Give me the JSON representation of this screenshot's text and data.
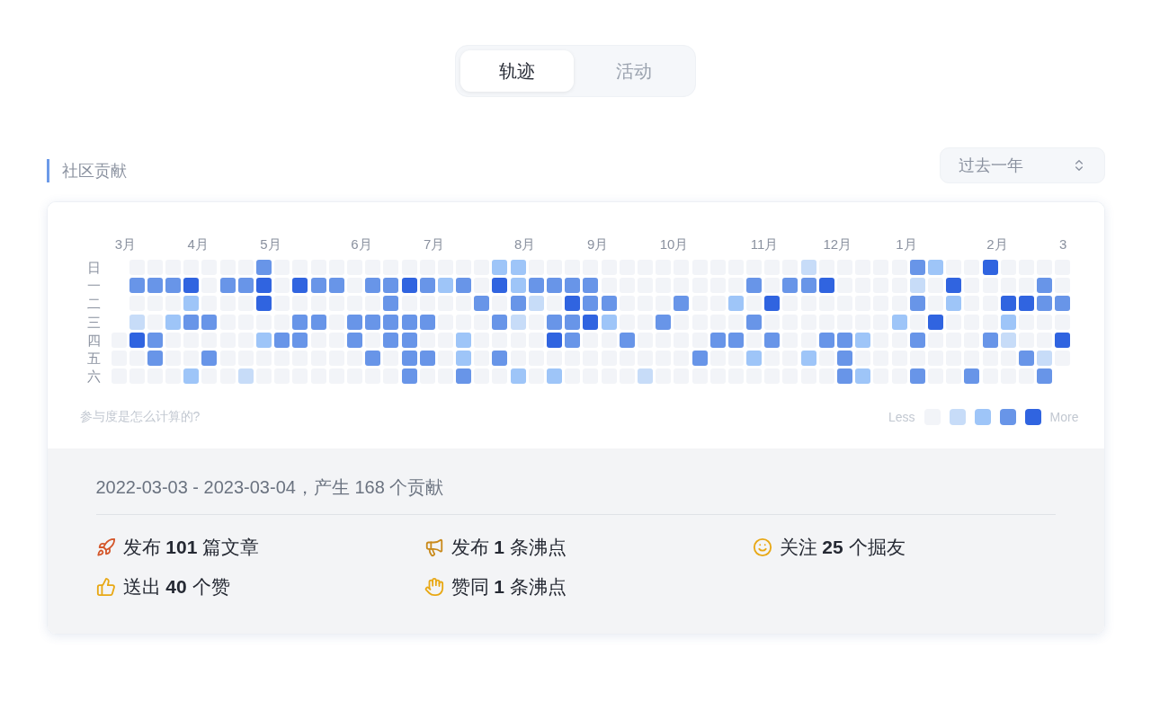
{
  "tabs": [
    {
      "label": "轨迹",
      "selected": true
    },
    {
      "label": "活动",
      "selected": false
    }
  ],
  "section": {
    "title": "社区贡献",
    "range_select": {
      "value": "过去一年"
    }
  },
  "heatmap": {
    "months": [
      "3月",
      "4月",
      "5月",
      "6月",
      "7月",
      "8月",
      "9月",
      "10月",
      "11月",
      "12月",
      "1月",
      "2月",
      "3"
    ],
    "days": [
      "日",
      "一",
      "二",
      "三",
      "四",
      "五",
      "六"
    ],
    "weeks": [
      {
        "days": [
          {
            "color": "#f2f4f8"
          },
          {
            "color": "#f2f4f8"
          },
          {
            "color": "#f2f4f8"
          }
        ]
      },
      {
        "days": [
          {
            "color": "#f2f4f8"
          },
          {
            "color": "#6895e8"
          },
          {
            "color": "#f2f4f8"
          },
          {
            "color": "#c7dcf8"
          },
          {
            "color": "#3064e0"
          },
          {
            "color": "#f2f4f8"
          },
          {
            "color": "#f2f4f8"
          }
        ]
      },
      {
        "days": [
          {
            "color": "#f2f4f8"
          },
          {
            "color": "#6895e8"
          },
          {
            "color": "#f2f4f8"
          },
          {
            "color": "#f2f4f8"
          },
          {
            "color": "#6895e8"
          },
          {
            "color": "#6895e8"
          },
          {
            "color": "#f2f4f8"
          }
        ]
      },
      {
        "days": [
          {
            "color": "#f2f4f8"
          },
          {
            "color": "#6895e8"
          },
          {
            "color": "#f2f4f8"
          },
          {
            "color": "#9ec5f8"
          },
          {
            "color": "#f2f4f8"
          },
          {
            "color": "#f2f4f8"
          },
          {
            "color": "#f2f4f8"
          }
        ]
      },
      {
        "days": [
          {
            "color": "#f2f4f8"
          },
          {
            "color": "#3064e0"
          },
          {
            "color": "#9ec5f8"
          },
          {
            "color": "#6895e8"
          },
          {
            "color": "#f2f4f8"
          },
          {
            "color": "#f2f4f8"
          },
          {
            "color": "#9ec5f8"
          }
        ]
      },
      {
        "days": [
          {
            "color": "#f2f4f8"
          },
          {
            "color": "#f2f4f8"
          },
          {
            "color": "#f2f4f8"
          },
          {
            "color": "#6895e8"
          },
          {
            "color": "#f2f4f8"
          },
          {
            "color": "#6895e8"
          },
          {
            "color": "#f2f4f8"
          }
        ]
      },
      {
        "days": [
          {
            "color": "#f2f4f8"
          },
          {
            "color": "#6895e8"
          },
          {
            "color": "#f2f4f8"
          },
          {
            "color": "#f2f4f8"
          },
          {
            "color": "#f2f4f8"
          },
          {
            "color": "#f2f4f8"
          },
          {
            "color": "#f2f4f8"
          }
        ]
      },
      {
        "days": [
          {
            "color": "#f2f4f8"
          },
          {
            "color": "#6895e8"
          },
          {
            "color": "#f2f4f8"
          },
          {
            "color": "#f2f4f8"
          },
          {
            "color": "#f2f4f8"
          },
          {
            "color": "#f2f4f8"
          },
          {
            "color": "#c7dcf8"
          }
        ]
      },
      {
        "days": [
          {
            "color": "#6895e8"
          },
          {
            "color": "#3064e0"
          },
          {
            "color": "#3064e0"
          },
          {
            "color": "#f2f4f8"
          },
          {
            "color": "#9ec5f8"
          },
          {
            "color": "#f2f4f8"
          },
          {
            "color": "#f2f4f8"
          }
        ]
      },
      {
        "days": [
          {
            "color": "#f2f4f8"
          },
          {
            "color": "#f2f4f8"
          },
          {
            "color": "#f2f4f8"
          },
          {
            "color": "#f2f4f8"
          },
          {
            "color": "#6895e8"
          },
          {
            "color": "#f2f4f8"
          },
          {
            "color": "#f2f4f8"
          }
        ]
      },
      {
        "days": [
          {
            "color": "#f2f4f8"
          },
          {
            "color": "#3064e0"
          },
          {
            "color": "#f2f4f8"
          },
          {
            "color": "#6895e8"
          },
          {
            "color": "#6895e8"
          },
          {
            "color": "#f2f4f8"
          },
          {
            "color": "#f2f4f8"
          }
        ]
      },
      {
        "days": [
          {
            "color": "#f2f4f8"
          },
          {
            "color": "#6895e8"
          },
          {
            "color": "#f2f4f8"
          },
          {
            "color": "#6895e8"
          },
          {
            "color": "#f2f4f8"
          },
          {
            "color": "#f2f4f8"
          },
          {
            "color": "#f2f4f8"
          }
        ]
      },
      {
        "days": [
          {
            "color": "#f2f4f8"
          },
          {
            "color": "#6895e8"
          },
          {
            "color": "#f2f4f8"
          },
          {
            "color": "#f2f4f8"
          },
          {
            "color": "#f2f4f8"
          },
          {
            "color": "#f2f4f8"
          },
          {
            "color": "#f2f4f8"
          }
        ]
      },
      {
        "days": [
          {
            "color": "#f2f4f8"
          },
          {
            "color": "#f2f4f8"
          },
          {
            "color": "#f2f4f8"
          },
          {
            "color": "#6895e8"
          },
          {
            "color": "#6895e8"
          },
          {
            "color": "#f2f4f8"
          },
          {
            "color": "#f2f4f8"
          }
        ]
      },
      {
        "days": [
          {
            "color": "#f2f4f8"
          },
          {
            "color": "#6895e8"
          },
          {
            "color": "#f2f4f8"
          },
          {
            "color": "#6895e8"
          },
          {
            "color": "#f2f4f8"
          },
          {
            "color": "#6895e8"
          },
          {
            "color": "#f2f4f8"
          }
        ]
      },
      {
        "days": [
          {
            "color": "#f2f4f8"
          },
          {
            "color": "#6895e8"
          },
          {
            "color": "#6895e8"
          },
          {
            "color": "#6895e8"
          },
          {
            "color": "#6895e8"
          },
          {
            "color": "#f2f4f8"
          },
          {
            "color": "#f2f4f8"
          }
        ]
      },
      {
        "days": [
          {
            "color": "#f2f4f8"
          },
          {
            "color": "#3064e0"
          },
          {
            "color": "#f2f4f8"
          },
          {
            "color": "#6895e8"
          },
          {
            "color": "#6895e8"
          },
          {
            "color": "#6895e8"
          },
          {
            "color": "#6895e8"
          }
        ]
      },
      {
        "days": [
          {
            "color": "#f2f4f8"
          },
          {
            "color": "#6895e8"
          },
          {
            "color": "#f2f4f8"
          },
          {
            "color": "#6895e8"
          },
          {
            "color": "#f2f4f8"
          },
          {
            "color": "#6895e8"
          },
          {
            "color": "#f2f4f8"
          }
        ]
      },
      {
        "days": [
          {
            "color": "#f2f4f8"
          },
          {
            "color": "#9ec5f8"
          },
          {
            "color": "#f2f4f8"
          },
          {
            "color": "#f2f4f8"
          },
          {
            "color": "#f2f4f8"
          },
          {
            "color": "#f2f4f8"
          },
          {
            "color": "#f2f4f8"
          }
        ]
      },
      {
        "days": [
          {
            "color": "#f2f4f8"
          },
          {
            "color": "#6895e8"
          },
          {
            "color": "#f2f4f8"
          },
          {
            "color": "#f2f4f8"
          },
          {
            "color": "#9ec5f8"
          },
          {
            "color": "#9ec5f8"
          },
          {
            "color": "#6895e8"
          }
        ]
      },
      {
        "days": [
          {
            "color": "#f2f4f8"
          },
          {
            "color": "#f2f4f8"
          },
          {
            "color": "#6895e8"
          },
          {
            "color": "#f2f4f8"
          },
          {
            "color": "#f2f4f8"
          },
          {
            "color": "#f2f4f8"
          },
          {
            "color": "#f2f4f8"
          }
        ]
      },
      {
        "days": [
          {
            "color": "#9ec5f8"
          },
          {
            "color": "#3064e0"
          },
          {
            "color": "#f2f4f8"
          },
          {
            "color": "#6895e8"
          },
          {
            "color": "#f2f4f8"
          },
          {
            "color": "#6895e8"
          },
          {
            "color": "#f2f4f8"
          }
        ]
      },
      {
        "days": [
          {
            "color": "#9ec5f8"
          },
          {
            "color": "#9ec5f8"
          },
          {
            "color": "#6895e8"
          },
          {
            "color": "#c7dcf8"
          },
          {
            "color": "#f2f4f8"
          },
          {
            "color": "#f2f4f8"
          },
          {
            "color": "#9ec5f8"
          }
        ]
      },
      {
        "days": [
          {
            "color": "#f2f4f8"
          },
          {
            "color": "#6895e8"
          },
          {
            "color": "#c7dcf8"
          },
          {
            "color": "#f2f4f8"
          },
          {
            "color": "#f2f4f8"
          },
          {
            "color": "#f2f4f8"
          },
          {
            "color": "#f2f4f8"
          }
        ]
      },
      {
        "days": [
          {
            "color": "#f2f4f8"
          },
          {
            "color": "#6895e8"
          },
          {
            "color": "#f2f4f8"
          },
          {
            "color": "#6895e8"
          },
          {
            "color": "#3064e0"
          },
          {
            "color": "#f2f4f8"
          },
          {
            "color": "#9ec5f8"
          }
        ]
      },
      {
        "days": [
          {
            "color": "#f2f4f8"
          },
          {
            "color": "#6895e8"
          },
          {
            "color": "#3064e0"
          },
          {
            "color": "#6895e8"
          },
          {
            "color": "#6895e8"
          },
          {
            "color": "#f2f4f8"
          },
          {
            "color": "#f2f4f8"
          }
        ]
      },
      {
        "days": [
          {
            "color": "#f2f4f8"
          },
          {
            "color": "#6895e8"
          },
          {
            "color": "#6895e8"
          },
          {
            "color": "#3064e0"
          },
          {
            "color": "#f2f4f8"
          },
          {
            "color": "#f2f4f8"
          },
          {
            "color": "#f2f4f8"
          }
        ]
      },
      {
        "days": [
          {
            "color": "#f2f4f8"
          },
          {
            "color": "#f2f4f8"
          },
          {
            "color": "#6895e8"
          },
          {
            "color": "#9ec5f8"
          },
          {
            "color": "#f2f4f8"
          },
          {
            "color": "#f2f4f8"
          },
          {
            "color": "#f2f4f8"
          }
        ]
      },
      {
        "days": [
          {
            "color": "#f2f4f8"
          },
          {
            "color": "#f2f4f8"
          },
          {
            "color": "#f2f4f8"
          },
          {
            "color": "#f2f4f8"
          },
          {
            "color": "#6895e8"
          },
          {
            "color": "#f2f4f8"
          },
          {
            "color": "#f2f4f8"
          }
        ]
      },
      {
        "days": [
          {
            "color": "#f2f4f8"
          },
          {
            "color": "#f2f4f8"
          },
          {
            "color": "#f2f4f8"
          },
          {
            "color": "#f2f4f8"
          },
          {
            "color": "#f2f4f8"
          },
          {
            "color": "#f2f4f8"
          },
          {
            "color": "#c7dcf8"
          }
        ]
      },
      {
        "days": [
          {
            "color": "#f2f4f8"
          },
          {
            "color": "#f2f4f8"
          },
          {
            "color": "#f2f4f8"
          },
          {
            "color": "#6895e8"
          },
          {
            "color": "#f2f4f8"
          },
          {
            "color": "#f2f4f8"
          },
          {
            "color": "#f2f4f8"
          }
        ]
      },
      {
        "days": [
          {
            "color": "#f2f4f8"
          },
          {
            "color": "#f2f4f8"
          },
          {
            "color": "#6895e8"
          },
          {
            "color": "#f2f4f8"
          },
          {
            "color": "#f2f4f8"
          },
          {
            "color": "#f2f4f8"
          },
          {
            "color": "#f2f4f8"
          }
        ]
      },
      {
        "days": [
          {
            "color": "#f2f4f8"
          },
          {
            "color": "#f2f4f8"
          },
          {
            "color": "#f2f4f8"
          },
          {
            "color": "#f2f4f8"
          },
          {
            "color": "#f2f4f8"
          },
          {
            "color": "#6895e8"
          },
          {
            "color": "#f2f4f8"
          }
        ]
      },
      {
        "days": [
          {
            "color": "#f2f4f8"
          },
          {
            "color": "#f2f4f8"
          },
          {
            "color": "#f2f4f8"
          },
          {
            "color": "#f2f4f8"
          },
          {
            "color": "#6895e8"
          },
          {
            "color": "#f2f4f8"
          },
          {
            "color": "#f2f4f8"
          }
        ]
      },
      {
        "days": [
          {
            "color": "#f2f4f8"
          },
          {
            "color": "#f2f4f8"
          },
          {
            "color": "#9ec5f8"
          },
          {
            "color": "#f2f4f8"
          },
          {
            "color": "#6895e8"
          },
          {
            "color": "#f2f4f8"
          },
          {
            "color": "#f2f4f8"
          }
        ]
      },
      {
        "days": [
          {
            "color": "#f2f4f8"
          },
          {
            "color": "#6895e8"
          },
          {
            "color": "#f2f4f8"
          },
          {
            "color": "#6895e8"
          },
          {
            "color": "#f2f4f8"
          },
          {
            "color": "#9ec5f8"
          },
          {
            "color": "#f2f4f8"
          }
        ]
      },
      {
        "days": [
          {
            "color": "#f2f4f8"
          },
          {
            "color": "#f2f4f8"
          },
          {
            "color": "#3064e0"
          },
          {
            "color": "#f2f4f8"
          },
          {
            "color": "#6895e8"
          },
          {
            "color": "#f2f4f8"
          },
          {
            "color": "#f2f4f8"
          }
        ]
      },
      {
        "days": [
          {
            "color": "#f2f4f8"
          },
          {
            "color": "#6895e8"
          },
          {
            "color": "#f2f4f8"
          },
          {
            "color": "#f2f4f8"
          },
          {
            "color": "#f2f4f8"
          },
          {
            "color": "#f2f4f8"
          },
          {
            "color": "#f2f4f8"
          }
        ]
      },
      {
        "days": [
          {
            "color": "#c7dcf8"
          },
          {
            "color": "#6895e8"
          },
          {
            "color": "#f2f4f8"
          },
          {
            "color": "#f2f4f8"
          },
          {
            "color": "#f2f4f8"
          },
          {
            "color": "#9ec5f8"
          },
          {
            "color": "#f2f4f8"
          }
        ]
      },
      {
        "days": [
          {
            "color": "#f2f4f8"
          },
          {
            "color": "#3064e0"
          },
          {
            "color": "#f2f4f8"
          },
          {
            "color": "#f2f4f8"
          },
          {
            "color": "#6895e8"
          },
          {
            "color": "#f2f4f8"
          },
          {
            "color": "#f2f4f8"
          }
        ]
      },
      {
        "days": [
          {
            "color": "#f2f4f8"
          },
          {
            "color": "#f2f4f8"
          },
          {
            "color": "#f2f4f8"
          },
          {
            "color": "#f2f4f8"
          },
          {
            "color": "#6895e8"
          },
          {
            "color": "#6895e8"
          },
          {
            "color": "#6895e8"
          }
        ]
      },
      {
        "days": [
          {
            "color": "#f2f4f8"
          },
          {
            "color": "#f2f4f8"
          },
          {
            "color": "#f2f4f8"
          },
          {
            "color": "#f2f4f8"
          },
          {
            "color": "#9ec5f8"
          },
          {
            "color": "#f2f4f8"
          },
          {
            "color": "#9ec5f8"
          }
        ]
      },
      {
        "days": [
          {
            "color": "#f2f4f8"
          },
          {
            "color": "#f2f4f8"
          },
          {
            "color": "#f2f4f8"
          },
          {
            "color": "#f2f4f8"
          },
          {
            "color": "#f2f4f8"
          },
          {
            "color": "#f2f4f8"
          },
          {
            "color": "#f2f4f8"
          }
        ]
      },
      {
        "days": [
          {
            "color": "#f2f4f8"
          },
          {
            "color": "#f2f4f8"
          },
          {
            "color": "#f2f4f8"
          },
          {
            "color": "#9ec5f8"
          },
          {
            "color": "#f2f4f8"
          },
          {
            "color": "#f2f4f8"
          },
          {
            "color": "#f2f4f8"
          }
        ]
      },
      {
        "days": [
          {
            "color": "#6895e8"
          },
          {
            "color": "#c7dcf8"
          },
          {
            "color": "#6895e8"
          },
          {
            "color": "#f2f4f8"
          },
          {
            "color": "#6895e8"
          },
          {
            "color": "#f2f4f8"
          },
          {
            "color": "#6895e8"
          }
        ]
      },
      {
        "days": [
          {
            "color": "#9ec5f8"
          },
          {
            "color": "#f2f4f8"
          },
          {
            "color": "#f2f4f8"
          },
          {
            "color": "#3064e0"
          },
          {
            "color": "#f2f4f8"
          },
          {
            "color": "#f2f4f8"
          },
          {
            "color": "#f2f4f8"
          }
        ]
      },
      {
        "days": [
          {
            "color": "#f2f4f8"
          },
          {
            "color": "#3064e0"
          },
          {
            "color": "#9ec5f8"
          },
          {
            "color": "#f2f4f8"
          },
          {
            "color": "#f2f4f8"
          },
          {
            "color": "#f2f4f8"
          },
          {
            "color": "#f2f4f8"
          }
        ]
      },
      {
        "days": [
          {
            "color": "#f2f4f8"
          },
          {
            "color": "#f2f4f8"
          },
          {
            "color": "#f2f4f8"
          },
          {
            "color": "#f2f4f8"
          },
          {
            "color": "#f2f4f8"
          },
          {
            "color": "#f2f4f8"
          },
          {
            "color": "#6895e8"
          }
        ]
      },
      {
        "days": [
          {
            "color": "#3064e0"
          },
          {
            "color": "#f2f4f8"
          },
          {
            "color": "#f2f4f8"
          },
          {
            "color": "#f2f4f8"
          },
          {
            "color": "#6895e8"
          },
          {
            "color": "#f2f4f8"
          },
          {
            "color": "#f2f4f8"
          }
        ]
      },
      {
        "days": [
          {
            "color": "#f2f4f8"
          },
          {
            "color": "#f2f4f8"
          },
          {
            "color": "#3064e0"
          },
          {
            "color": "#9ec5f8"
          },
          {
            "color": "#c7dcf8"
          },
          {
            "color": "#f2f4f8"
          },
          {
            "color": "#f2f4f8"
          }
        ]
      },
      {
        "days": [
          {
            "color": "#f2f4f8"
          },
          {
            "color": "#f2f4f8"
          },
          {
            "color": "#3064e0"
          },
          {
            "color": "#f2f4f8"
          },
          {
            "color": "#f2f4f8"
          },
          {
            "color": "#6895e8"
          },
          {
            "color": "#f2f4f8"
          }
        ]
      },
      {
        "days": [
          {
            "color": "#f2f4f8"
          },
          {
            "color": "#6895e8"
          },
          {
            "color": "#6895e8"
          },
          {
            "color": "#f2f4f8"
          },
          {
            "color": "#f2f4f8"
          },
          {
            "color": "#c7dcf8"
          },
          {
            "color": "#6895e8"
          }
        ]
      },
      {
        "days": [
          {
            "color": "#f2f4f8"
          },
          {
            "color": "#f2f4f8"
          },
          {
            "color": "#6895e8"
          },
          {
            "color": "#f2f4f8"
          },
          {
            "color": "#3064e0"
          },
          {
            "color": "#f2f4f8"
          }
        ]
      }
    ],
    "help_link": "参与度是怎么计算的?",
    "legend": {
      "less": "Less",
      "more": "More",
      "swatches": [
        {
          "color": "#f2f4f8"
        },
        {
          "color": "#c7dcf8"
        },
        {
          "color": "#9ec5f8"
        },
        {
          "color": "#6895e8"
        },
        {
          "color": "#3064e0"
        }
      ]
    }
  },
  "summary": {
    "text": "2022-03-03 - 2023-03-04，产生 168 个贡献",
    "stats": [
      {
        "kind": "rocket",
        "text": "发布 **101** 篇文章"
      },
      {
        "kind": "megaphone",
        "text": "发布 **1** 条沸点"
      },
      {
        "kind": "smile",
        "text": "关注 **25** 个掘友"
      },
      {
        "kind": "thumbs",
        "text": "送出 **40** 个赞"
      },
      {
        "kind": "clap",
        "text": "赞同 **1** 条沸点"
      }
    ]
  }
}
